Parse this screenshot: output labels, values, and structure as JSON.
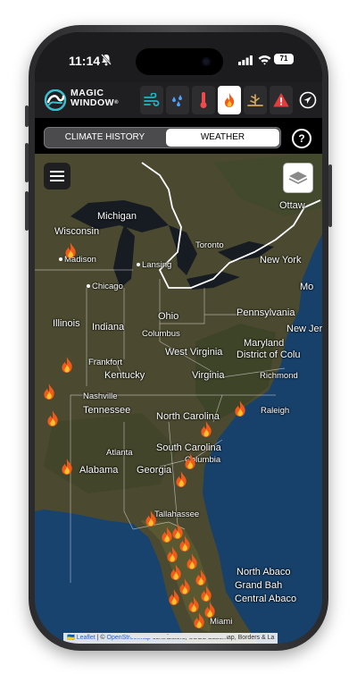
{
  "status": {
    "time": "11:14",
    "battery": "71"
  },
  "app": {
    "logo_line1": "MAGIC",
    "logo_line2": "WINDOW",
    "logo_mark": "®"
  },
  "toolbar": {
    "items": [
      {
        "id": "wind",
        "icon": "wind-icon",
        "active": false
      },
      {
        "id": "precip",
        "icon": "raindrops-icon",
        "active": false
      },
      {
        "id": "temperature",
        "icon": "thermometer-icon",
        "active": false
      },
      {
        "id": "fire",
        "icon": "fire-icon",
        "active": true
      },
      {
        "id": "drought",
        "icon": "drought-icon",
        "active": false
      },
      {
        "id": "alerts",
        "icon": "warning-icon",
        "active": false
      }
    ],
    "nav_icon": "navigation-arrow-icon"
  },
  "tabs": {
    "history": "CLIMATE HISTORY",
    "weather": "WEATHER",
    "selected": "WEATHER"
  },
  "help": "?",
  "map": {
    "labels": {
      "ottawa": "Ottaw",
      "michigan": "Michigan",
      "wisconsin": "Wisconsin",
      "madison": "Madison",
      "lansing": "Lansing",
      "toronto": "Toronto",
      "new_york": "New York",
      "chicago": "Chicago",
      "mo": "Mo",
      "illinois": "Illinois",
      "indiana": "Indiana",
      "ohio": "Ohio",
      "columbus": "Columbus",
      "pennsylvania": "Pennsylvania",
      "new_jersey": "New Jers",
      "maryland": "Maryland",
      "district_of_columbia": "District of Colu",
      "west_virginia": "West Virginia",
      "frankfort": "Frankfort",
      "kentucky": "Kentucky",
      "virginia": "Virginia",
      "richmond": "Richmond",
      "nashville": "Nashville",
      "tennessee": "Tennessee",
      "north_carolina": "North Carolina",
      "raleigh": "Raleigh",
      "atlanta": "Atlanta",
      "south_carolina": "South Carolina",
      "columbia": "Columbia",
      "alabama": "Alabama",
      "georgia": "Georgia",
      "tallahassee": "Tallahassee",
      "north_abaco": "North Abaco",
      "grand_bahama": "Grand Bah",
      "central_abaco": "Central Abaco",
      "miami": "Miami"
    },
    "attribution": {
      "flag": "🇺🇦",
      "leaflet": "Leaflet",
      "sep": " | © ",
      "osm": "OpenStreetMap",
      "rest": " contributors, USGS Basemap, Borders & La"
    }
  },
  "colors": {
    "accent": "#1fb6c9",
    "fire": "#f25a1a",
    "alert": "#e23d3d",
    "ocean": "#17406a",
    "land": "#4b4a30"
  }
}
